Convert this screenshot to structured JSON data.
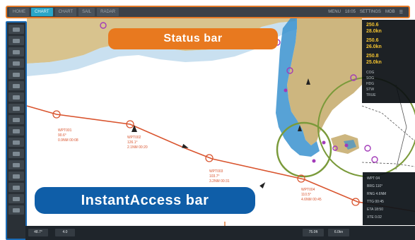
{
  "status_bar": {
    "tabs": [
      {
        "label": "HOME"
      },
      {
        "label": "CHART",
        "active": true
      },
      {
        "label": "CHART"
      },
      {
        "label": "SAIL"
      },
      {
        "label": "RADAR"
      }
    ],
    "right_items": [
      "MENU",
      "18:05",
      "SETTINGS",
      "MOB",
      "☰"
    ]
  },
  "callouts": {
    "status_bar": "Status bar",
    "instant_access_bar": "InstantAccess bar"
  },
  "waypoints": [
    {
      "name": "WPT001",
      "range": "90.6°",
      "time": "0.9NM 00:08"
    },
    {
      "name": "WPT002",
      "range": "126.1°",
      "time": "2.1NM 00:20"
    },
    {
      "name": "WPT003",
      "range": "103.7°",
      "time": "3.2NM 00:31"
    },
    {
      "name": "WPT004",
      "range": "110.5°",
      "time": "4.6NM 00:45"
    }
  ],
  "data_panel": {
    "rows": [
      "250.6",
      "28.0kn",
      "250.6",
      "26.0kn",
      "250.8",
      "25.0kn"
    ],
    "small": [
      "COG",
      "SOG",
      "HDG",
      "STW",
      "TRUE"
    ]
  },
  "info_panel": {
    "rows": [
      "WPT 04",
      "BRG 110°",
      "RNG 4.6NM",
      "TTG 00:45",
      "ETA 18:50",
      "XTE 0.02"
    ]
  },
  "bottom_bar": {
    "items": [
      "48.7°",
      "4.0",
      "75.0ft",
      "6.0kn"
    ]
  },
  "colors": {
    "status_border": "#e57a28",
    "ia_border": "#1a6bb5",
    "route": "#d9542e",
    "land": "#d8c38e",
    "sea": "#ffffff"
  }
}
